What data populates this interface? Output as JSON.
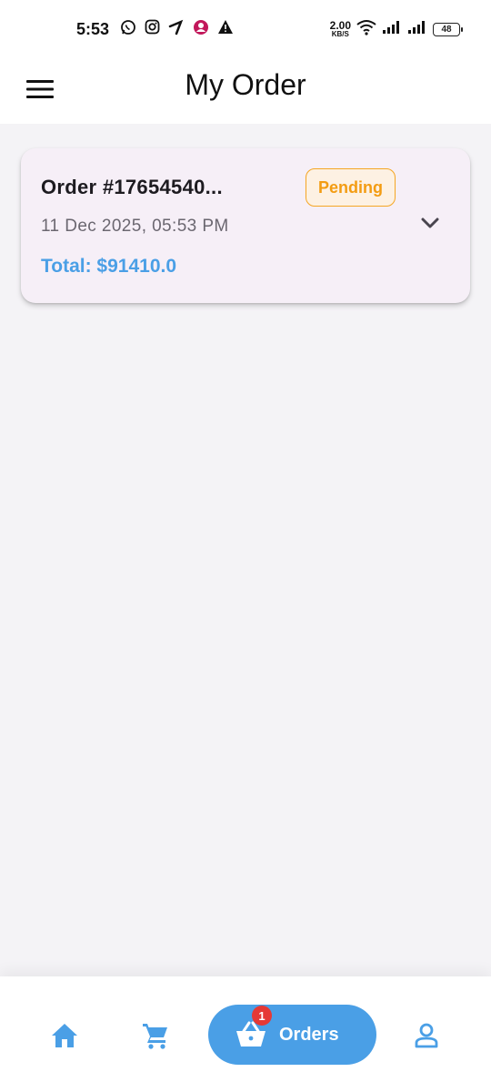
{
  "status_bar": {
    "time": "5:53",
    "net_speed": "2.00",
    "net_speed_unit": "KB/S",
    "battery": "48",
    "icons": [
      "whatsapp-icon",
      "instagram-icon",
      "telenor-icon",
      "profile-circle-icon",
      "warning-icon",
      "wifi-icon",
      "signal-icon",
      "signal-icon",
      "battery-icon"
    ]
  },
  "app_bar": {
    "title": "My Order",
    "menu_icon": "hamburger-menu-icon"
  },
  "orders": [
    {
      "id_label": "Order #17654540...",
      "status": "Pending",
      "date": "11 Dec 2025, 05:53 PM",
      "total": "Total: $91410.0"
    }
  ],
  "bottom_nav": {
    "items": [
      {
        "name": "home",
        "icon": "home-icon",
        "active": false
      },
      {
        "name": "cart",
        "icon": "cart-icon",
        "active": false
      },
      {
        "name": "orders",
        "icon": "basket-icon",
        "label": "Orders",
        "badge": "1",
        "active": true
      },
      {
        "name": "profile",
        "icon": "person-icon",
        "active": false
      }
    ]
  },
  "colors": {
    "accent": "#4a9fe6",
    "pending": "#f39c12",
    "card_bg": "#f6eff7",
    "page_bg": "#f4f3f6",
    "badge_red": "#e53935"
  }
}
